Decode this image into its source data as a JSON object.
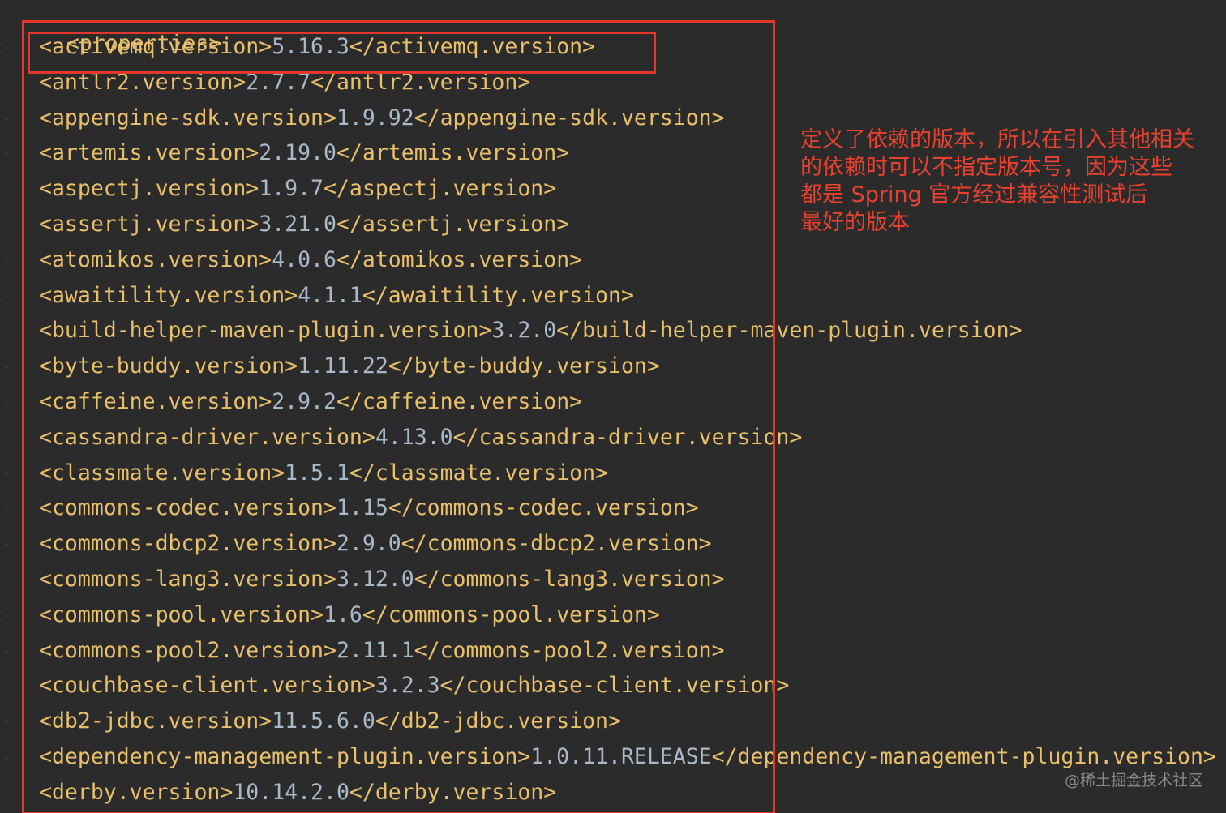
{
  "root_tag": "<properties>",
  "lines": [
    {
      "open": "<activemq.version>",
      "value": "5.16.3",
      "close": "</activemq.version>"
    },
    {
      "open": "<antlr2.version>",
      "value": "2.7.7",
      "close": "</antlr2.version>"
    },
    {
      "open": "<appengine-sdk.version>",
      "value": "1.9.92",
      "close": "</appengine-sdk.version>"
    },
    {
      "open": "<artemis.version>",
      "value": "2.19.0",
      "close": "</artemis.version>"
    },
    {
      "open": "<aspectj.version>",
      "value": "1.9.7",
      "close": "</aspectj.version>"
    },
    {
      "open": "<assertj.version>",
      "value": "3.21.0",
      "close": "</assertj.version>"
    },
    {
      "open": "<atomikos.version>",
      "value": "4.0.6",
      "close": "</atomikos.version>"
    },
    {
      "open": "<awaitility.version>",
      "value": "4.1.1",
      "close": "</awaitility.version>"
    },
    {
      "open": "<build-helper-maven-plugin.version>",
      "value": "3.2.0",
      "close": "</build-helper-maven-plugin.version>"
    },
    {
      "open": "<byte-buddy.version>",
      "value": "1.11.22",
      "close": "</byte-buddy.version>"
    },
    {
      "open": "<caffeine.version>",
      "value": "2.9.2",
      "close": "</caffeine.version>"
    },
    {
      "open": "<cassandra-driver.version>",
      "value": "4.13.0",
      "close": "</cassandra-driver.version>"
    },
    {
      "open": "<classmate.version>",
      "value": "1.5.1",
      "close": "</classmate.version>"
    },
    {
      "open": "<commons-codec.version>",
      "value": "1.15",
      "close": "</commons-codec.version>"
    },
    {
      "open": "<commons-dbcp2.version>",
      "value": "2.9.0",
      "close": "</commons-dbcp2.version>"
    },
    {
      "open": "<commons-lang3.version>",
      "value": "3.12.0",
      "close": "</commons-lang3.version>"
    },
    {
      "open": "<commons-pool.version>",
      "value": "1.6",
      "close": "</commons-pool.version>"
    },
    {
      "open": "<commons-pool2.version>",
      "value": "2.11.1",
      "close": "</commons-pool2.version>"
    },
    {
      "open": "<couchbase-client.version>",
      "value": "3.2.3",
      "close": "</couchbase-client.version>"
    },
    {
      "open": "<db2-jdbc.version>",
      "value": "11.5.6.0",
      "close": "</db2-jdbc.version>"
    },
    {
      "open": "<dependency-management-plugin.version>",
      "value": "1.0.11.RELEASE",
      "close": "</dependency-management-plugin.version>"
    },
    {
      "open": "<derby.version>",
      "value": "10.14.2.0",
      "close": "</derby.version>"
    }
  ],
  "annotation": "定义了依赖的版本，所以在引入其他相关\n的依赖时可以不指定版本号，因为这些\n都是 Spring 官方经过兼容性测试后\n最好的版本",
  "watermark": "@稀土掘金技术社区",
  "colors": {
    "background": "#2b2b2c",
    "tag": "#e8bf6a",
    "value": "#a9b7c6",
    "highlight_box": "#e2372a",
    "annotation": "#e8412f"
  }
}
